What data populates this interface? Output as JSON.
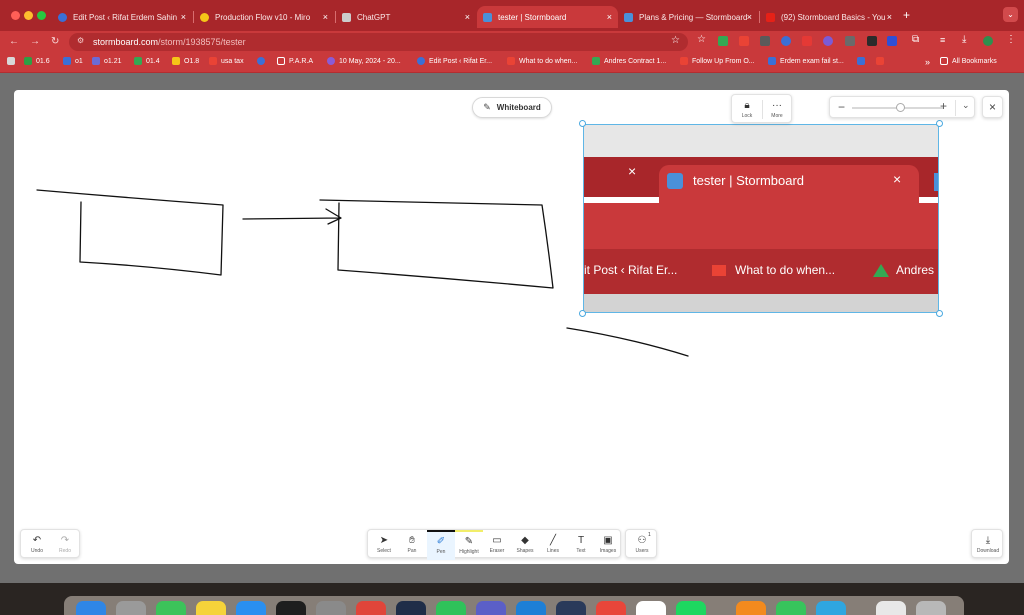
{
  "browser": {
    "tabs": [
      {
        "label": "Edit Post ‹ Rifat Erdem Sahin",
        "favicon": "wordpress-icon",
        "color": "#3b6fd6"
      },
      {
        "label": "Production Flow v10 - Miro",
        "favicon": "miro-icon",
        "color": "#f5c518"
      },
      {
        "label": "ChatGPT",
        "favicon": "chatgpt-icon",
        "color": "#cccccc"
      },
      {
        "label": "tester | Stormboard",
        "favicon": "stormboard-icon",
        "color": "#4a90d9",
        "active": true
      },
      {
        "label": "Plans & Pricing — Stormboard",
        "favicon": "stormboard-icon",
        "color": "#4a90d9"
      },
      {
        "label": "(92) Stormboard Basics - You",
        "favicon": "youtube-icon",
        "color": "#e62117"
      }
    ],
    "new_tab": "+",
    "close_glyph": "×",
    "url_host": "stormboard.com",
    "url_path": "/storm/1938575/tester",
    "bookmarks": [
      {
        "label": "01.6",
        "color": "#2f9e44"
      },
      {
        "label": "o1",
        "color": "#3b6fd6"
      },
      {
        "label": "o1.21",
        "color": "#6b6bd6"
      },
      {
        "label": "01.4",
        "color": "#34a853"
      },
      {
        "label": "O1.8",
        "color": "#f5c518"
      },
      {
        "label": "usa tax",
        "color": "#ea4335"
      },
      {
        "label": "",
        "color": "#3b6fd6"
      },
      {
        "label": "P.A.R.A",
        "color": "#cccccc"
      },
      {
        "label": "10 May, 2024 - 20...",
        "color": "#8a5bd6"
      },
      {
        "label": "Edit Post ‹ Rifat Er...",
        "color": "#3b6fd6"
      },
      {
        "label": "What to do when...",
        "color": "#ea4335"
      },
      {
        "label": "Andres Contract 1...",
        "color": "#34a853"
      },
      {
        "label": "Follow Up From O...",
        "color": "#ea4335"
      },
      {
        "label": "Erdem exam fail st...",
        "color": "#3b6fd6"
      }
    ],
    "all_bookmarks": "All Bookmarks"
  },
  "board": {
    "mode_label": "Whiteboard",
    "lock_label": "Lock",
    "more_label": "More",
    "zoom_minus": "−",
    "zoom_plus": "+",
    "zoom_level": 0.5,
    "undo_label": "Undo",
    "redo_label": "Redo",
    "download_label": "Download",
    "users_label": "Users",
    "users_count": "1",
    "tools": [
      {
        "label": "Select",
        "icon": "cursor-icon"
      },
      {
        "label": "Pan",
        "icon": "hand-icon"
      },
      {
        "label": "Pen",
        "icon": "pen-icon",
        "selected": true
      },
      {
        "label": "Highlight",
        "icon": "highlighter-icon"
      },
      {
        "label": "Eraser",
        "icon": "eraser-icon"
      },
      {
        "label": "Shapes",
        "icon": "shapes-icon"
      },
      {
        "label": "Lines",
        "icon": "line-icon"
      },
      {
        "label": "Text",
        "icon": "text-icon"
      },
      {
        "label": "Images",
        "icon": "image-icon"
      }
    ]
  },
  "embedded": {
    "tab_label": "tester | Stormboard",
    "bm1": "it Post ‹ Rifat Er...",
    "bm2": "What to do when...",
    "bm3": "Andres",
    "close_glyph": "×"
  },
  "colors": {
    "chrome_red": "#c9393b",
    "tab_strip": "#a8262a",
    "accent_blue": "#2a7bd6",
    "selection": "#5fb6e6"
  }
}
